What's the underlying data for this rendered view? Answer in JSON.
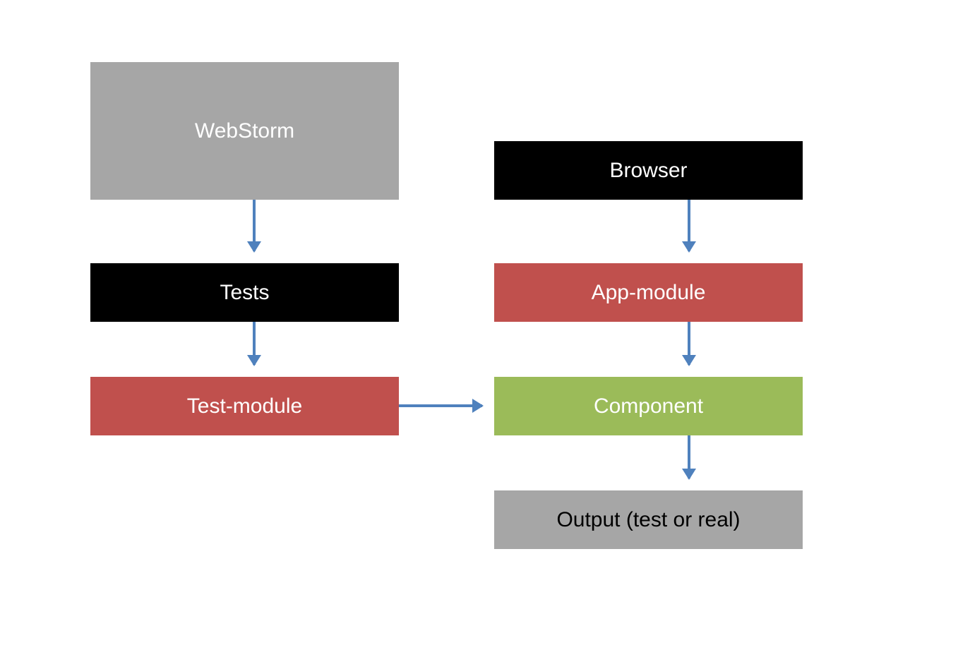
{
  "nodes": {
    "webstorm": {
      "label": "WebStorm",
      "color": "gray-light",
      "text_color": "white"
    },
    "tests": {
      "label": "Tests",
      "color": "black",
      "text_color": "white"
    },
    "test_module": {
      "label": "Test-module",
      "color": "red",
      "text_color": "white"
    },
    "browser": {
      "label": "Browser",
      "color": "black",
      "text_color": "white"
    },
    "app_module": {
      "label": "App-module",
      "color": "red",
      "text_color": "white"
    },
    "component": {
      "label": "Component",
      "color": "green",
      "text_color": "white"
    },
    "output": {
      "label": "Output (test or real)",
      "color": "gray-light",
      "text_color": "black"
    }
  },
  "edges": [
    {
      "from": "webstorm",
      "to": "tests"
    },
    {
      "from": "tests",
      "to": "test_module"
    },
    {
      "from": "test_module",
      "to": "component"
    },
    {
      "from": "browser",
      "to": "app_module"
    },
    {
      "from": "app_module",
      "to": "component"
    },
    {
      "from": "component",
      "to": "output"
    }
  ],
  "colors": {
    "gray-light": "#a6a6a6",
    "black": "#000000",
    "red": "#c0504d",
    "green": "#9bbb59",
    "arrow": "#4f81bd"
  }
}
